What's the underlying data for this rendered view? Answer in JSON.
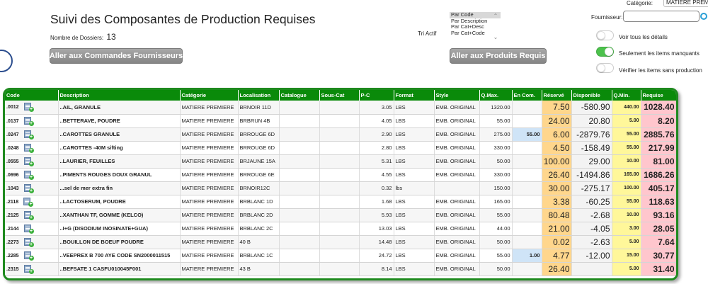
{
  "header": {
    "title": "Suivi des Composantes de Production Requises",
    "dossiers_label": "Nombre de Dossiers:",
    "dossiers_count": "13",
    "btn_commandes": "Aller aux Commandes Fournisseurs",
    "btn_produits": "Aller aux Produits Requis",
    "tri_label": "Tri Actif",
    "sort_options": [
      "Par Code",
      "Par Description",
      "Par Cat+Desc",
      "Par Cat+Code"
    ],
    "sort_selected": "Par Code",
    "categorie_label": "Catégorie:",
    "categorie_value": "MATIERE PREMIERE",
    "fournisseur_label": "Fournisseur:",
    "fournisseur_value": "",
    "toggles": [
      {
        "label": "Voir tous les détails",
        "on": false
      },
      {
        "label": "Seulement les items manquants",
        "on": true
      },
      {
        "label": "Vérifier les items sans production",
        "on": false
      }
    ]
  },
  "table": {
    "columns": [
      "Code",
      "Description",
      "Catégorie",
      "Localisation",
      "Catalogue",
      "Sous-Cat",
      "P-C",
      "Format",
      "Style",
      "Q.Max.",
      "En Com.",
      "Réservé",
      "Disponible",
      "Q.Min.",
      "Requise"
    ],
    "rows": [
      {
        "code": ".0012",
        "desc": "..AIL, GRANULE",
        "cat": "MATIERE PREMIERE",
        "loc": "BRNOIR 11D",
        "catalogue": "",
        "souscat": "",
        "pc": "3.05",
        "format": "LBS",
        "style": "EMB. ORIGINAL",
        "qmax": "1320.00",
        "encom": "",
        "res": "7.50",
        "disp": "-580.90",
        "qmin": "440.00",
        "req": "1028.40"
      },
      {
        "code": ".0137",
        "desc": "..BETTERAVE, POUDRE",
        "cat": "MATIERE PREMIERE",
        "loc": "BRBRUN 4B",
        "catalogue": "",
        "souscat": "",
        "pc": "4.05",
        "format": "LBS",
        "style": "EMB. ORIGINAL",
        "qmax": "55.00",
        "encom": "",
        "res": "24.00",
        "disp": "20.80",
        "qmin": "5.00",
        "req": "8.20"
      },
      {
        "code": ".0247",
        "desc": "..CAROTTES GRANULE",
        "cat": "MATIERE PREMIERE",
        "loc": "BRROUGE 6D",
        "catalogue": "",
        "souscat": "",
        "pc": "2.90",
        "format": "LBS",
        "style": "EMB. ORIGINAL",
        "qmax": "275.00",
        "encom": "55.00",
        "res": "6.00",
        "disp": "-2879.76",
        "qmin": "55.00",
        "req": "2885.76"
      },
      {
        "code": ".0248",
        "desc": "..CAROTTES -40M sifting",
        "cat": "MATIERE PREMIERE",
        "loc": "BRROUGE 6D",
        "catalogue": "",
        "souscat": "",
        "pc": "2.80",
        "format": "LBS",
        "style": "EMB. ORIGINAL",
        "qmax": "330.00",
        "encom": "",
        "res": "4.50",
        "disp": "-158.49",
        "qmin": "55.00",
        "req": "217.99"
      },
      {
        "code": ".0555",
        "desc": "..LAURIER, FEUILLES",
        "cat": "MATIERE PREMIERE",
        "loc": "BRJAUNE 15A",
        "catalogue": "",
        "souscat": "",
        "pc": "5.31",
        "format": "LBS",
        "style": "EMB. ORIGINAL",
        "qmax": "50.00",
        "encom": "",
        "res": "100.00",
        "disp": "29.00",
        "qmin": "10.00",
        "req": "81.00"
      },
      {
        "code": ".0696",
        "desc": "..PIMENTS ROUGES DOUX GRANUL",
        "cat": "MATIERE PREMIERE",
        "loc": "BRROUGE 6E",
        "catalogue": "",
        "souscat": "",
        "pc": "4.55",
        "format": "LBS",
        "style": "EMB. ORIGINAL",
        "qmax": "330.00",
        "encom": "",
        "res": "26.40",
        "disp": "-1494.86",
        "qmin": "165.00",
        "req": "1686.26"
      },
      {
        "code": ".1043",
        "desc": "...sel de mer extra fin",
        "cat": "MATIERE PREMIERE",
        "loc": "BRNOIR12C",
        "catalogue": "",
        "souscat": "",
        "pc": "0.32",
        "format": "lbs",
        "style": "",
        "qmax": "150.00",
        "encom": "",
        "res": "30.00",
        "disp": "-275.17",
        "qmin": "100.00",
        "req": "405.17"
      },
      {
        "code": ".2118",
        "desc": "..LACTOSERUM, POUDRE",
        "cat": "MATIERE PREMIERE",
        "loc": "BRBLANC 1D",
        "catalogue": "",
        "souscat": "",
        "pc": "1.68",
        "format": "LBS",
        "style": "EMB. ORIGINAL",
        "qmax": "165.00",
        "encom": "",
        "res": "3.38",
        "disp": "-60.25",
        "qmin": "55.00",
        "req": "118.63"
      },
      {
        "code": ".2125",
        "desc": "..XANTHAN TF, GOMME (KELCO)",
        "cat": "MATIERE PREMIERE",
        "loc": "BRBLANC 2D",
        "catalogue": "",
        "souscat": "",
        "pc": "5.93",
        "format": "LBS",
        "style": "EMB. ORIGINAL",
        "qmax": "55.00",
        "encom": "",
        "res": "80.48",
        "disp": "-2.68",
        "qmin": "10.00",
        "req": "93.16"
      },
      {
        "code": ".2144",
        "desc": "..I+G (DISODIUM INOSINATE+GUA)",
        "cat": "MATIERE PREMIERE",
        "loc": "BRBLANC 2C",
        "catalogue": "",
        "souscat": "",
        "pc": "13.03",
        "format": "LBS",
        "style": "EMB. ORIGINAL",
        "qmax": "44.00",
        "encom": "",
        "res": "21.00",
        "disp": "-4.05",
        "qmin": "3.00",
        "req": "28.05"
      },
      {
        "code": ".2273",
        "desc": "..BOUILLON DE BOEUF POUDRE",
        "cat": "MATIERE PREMIERE",
        "loc": "40 B",
        "catalogue": "",
        "souscat": "",
        "pc": "14.48",
        "format": "LBS",
        "style": "EMB. ORIGINAL",
        "qmax": "50.00",
        "encom": "",
        "res": "0.02",
        "disp": "-2.63",
        "qmin": "5.00",
        "req": "7.64"
      },
      {
        "code": ".2285",
        "desc": "..VEEPREX B 700 AYE CODE SN2000011515",
        "cat": "MATIERE PREMIERE",
        "loc": "BRBLANC 1C",
        "catalogue": "",
        "souscat": "",
        "pc": "24.72",
        "format": "LBS",
        "style": "EMB. ORIGINAL",
        "qmax": "55.00",
        "encom": "1.00",
        "res": "4.77",
        "disp": "-12.00",
        "qmin": "15.00",
        "req": "30.77"
      },
      {
        "code": ".2315",
        "desc": "..BEFSATE 1 CASFU010045F001",
        "cat": "MATIERE PREMIERE",
        "loc": "43 B",
        "catalogue": "",
        "souscat": "",
        "pc": "8.14",
        "format": "LBS",
        "style": "EMB. ORIGINAL",
        "qmax": "50.00",
        "encom": "",
        "res": "26.40",
        "disp": "",
        "qmin": "5.00",
        "req": "31.40"
      }
    ]
  },
  "icons": {
    "row_action": "add-document-icon",
    "search": "search-icon"
  },
  "colors": {
    "header_green": "#0a8a0a",
    "reserve": "#ffd68c",
    "qmin": "#fff79a",
    "requise": "#ffc6cd",
    "encom": "#cfe4f7"
  }
}
